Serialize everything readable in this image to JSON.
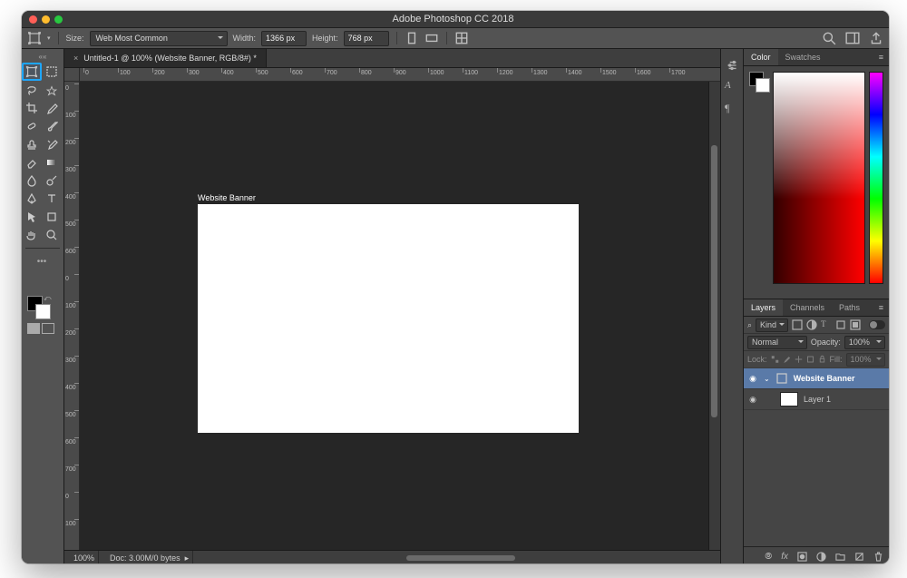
{
  "title": "Adobe Photoshop CC 2018",
  "options": {
    "size_label": "Size:",
    "preset": "Web Most Common",
    "width_label": "Width:",
    "width_value": "1366 px",
    "height_label": "Height:",
    "height_value": "768 px"
  },
  "tab": {
    "title": "Untitled-1 @ 100% (Website Banner, RGB/8#) *"
  },
  "hruler_ticks": [
    "0",
    "100",
    "200",
    "300",
    "400",
    "500",
    "600",
    "700",
    "800",
    "900",
    "1000",
    "1100",
    "1200",
    "1300",
    "1400",
    "1500",
    "1600",
    "1700"
  ],
  "vruler_ticks": [
    "0",
    "100",
    "200",
    "300",
    "400",
    "500",
    "600",
    "0",
    "100",
    "200",
    "300",
    "400",
    "500",
    "600",
    "700",
    "0",
    "100"
  ],
  "artboard_label": "Website Banner",
  "status": {
    "zoom": "100%",
    "doc": "Doc: 3.00M/0 bytes"
  },
  "color_panel": {
    "tab1": "Color",
    "tab2": "Swatches"
  },
  "layers_panel": {
    "tab1": "Layers",
    "tab2": "Channels",
    "tab3": "Paths",
    "kind_label": "Kind",
    "blend": "Normal",
    "opacity_label": "Opacity:",
    "opacity_value": "100%",
    "lock_label": "Lock:",
    "fill_label": "Fill:",
    "fill_value": "100%",
    "group": "Website Banner",
    "layer1": "Layer 1",
    "search_icon": "⌕"
  },
  "icons": {
    "link": "⧉",
    "fx": "fx"
  }
}
